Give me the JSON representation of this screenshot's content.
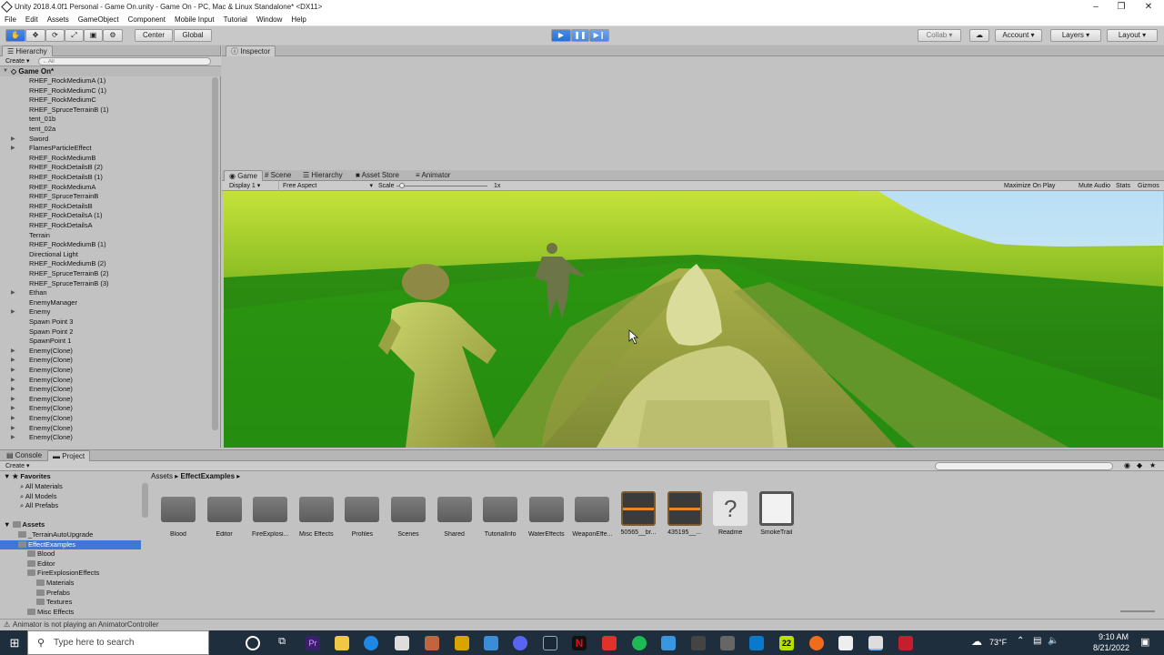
{
  "window": {
    "title": "Unity 2018.4.0f1 Personal - Game On.unity - Game On - PC, Mac & Linux Standalone* <DX11>"
  },
  "menu": [
    "File",
    "Edit",
    "Assets",
    "GameObject",
    "Component",
    "Mobile Input",
    "Tutorial",
    "Window",
    "Help"
  ],
  "toolbar": {
    "center_label": "Center",
    "global_label": "Global",
    "collab_label": "Collab ▾",
    "account_label": "Account",
    "layers_label": "Layers",
    "layout_label": "Layout"
  },
  "hierarchy": {
    "tab": "Hierarchy",
    "create_label": "Create ▾",
    "search_placeholder": "←All",
    "scene_name": "Game On*",
    "items": [
      {
        "name": "RHEF_RockMediumA (1)",
        "arrow": false
      },
      {
        "name": "RHEF_RockMediumC (1)",
        "arrow": false
      },
      {
        "name": "RHEF_RockMediumC",
        "arrow": false
      },
      {
        "name": "RHEF_SpruceTerrainB (1)",
        "arrow": false
      },
      {
        "name": "tent_01b",
        "arrow": false
      },
      {
        "name": "tent_02a",
        "arrow": false
      },
      {
        "name": "Sword",
        "arrow": true
      },
      {
        "name": "FlamesParticleEffect",
        "arrow": true
      },
      {
        "name": "RHEF_RockMediumB",
        "arrow": false
      },
      {
        "name": "RHEF_RockDetailsB (2)",
        "arrow": false
      },
      {
        "name": "RHEF_RockDetailsB (1)",
        "arrow": false
      },
      {
        "name": "RHEF_RockMediumA",
        "arrow": false
      },
      {
        "name": "RHEF_SpruceTerrainB",
        "arrow": false
      },
      {
        "name": "RHEF_RockDetailsB",
        "arrow": false
      },
      {
        "name": "RHEF_RockDetailsA (1)",
        "arrow": false
      },
      {
        "name": "RHEF_RockDetailsA",
        "arrow": false
      },
      {
        "name": "Terrain",
        "arrow": false
      },
      {
        "name": "RHEF_RockMediumB (1)",
        "arrow": false
      },
      {
        "name": "Directional Light",
        "arrow": false
      },
      {
        "name": "RHEF_RockMediumB (2)",
        "arrow": false
      },
      {
        "name": "RHEF_SpruceTerrainB (2)",
        "arrow": false
      },
      {
        "name": "RHEF_SpruceTerrainB (3)",
        "arrow": false
      },
      {
        "name": "Ethan",
        "arrow": true
      },
      {
        "name": "EnemyManager",
        "arrow": false
      },
      {
        "name": "Enemy",
        "arrow": true
      },
      {
        "name": "Spawn Point 3",
        "arrow": false
      },
      {
        "name": "Spawn Point 2",
        "arrow": false
      },
      {
        "name": "SpawnPoint 1",
        "arrow": false
      },
      {
        "name": "Enemy(Clone)",
        "arrow": true
      },
      {
        "name": "Enemy(Clone)",
        "arrow": true
      },
      {
        "name": "Enemy(Clone)",
        "arrow": true
      },
      {
        "name": "Enemy(Clone)",
        "arrow": true
      },
      {
        "name": "Enemy(Clone)",
        "arrow": true
      },
      {
        "name": "Enemy(Clone)",
        "arrow": true
      },
      {
        "name": "Enemy(Clone)",
        "arrow": true
      },
      {
        "name": "Enemy(Clone)",
        "arrow": true
      },
      {
        "name": "Enemy(Clone)",
        "arrow": true
      },
      {
        "name": "Enemy(Clone)",
        "arrow": true
      }
    ]
  },
  "inspector": {
    "tab": "Inspector"
  },
  "game": {
    "tabs": [
      "Game",
      "Scene",
      "Hierarchy",
      "Asset Store",
      "Animator"
    ],
    "display": "Display 1",
    "aspect": "Free Aspect",
    "scale_label": "Scale",
    "scale_value": "1x",
    "options": [
      "Maximize On Play",
      "Mute Audio",
      "Stats",
      "Gizmos"
    ]
  },
  "project": {
    "tabs": [
      "Console",
      "Project"
    ],
    "create_label": "Create ▾",
    "breadcrumb": [
      "Assets",
      "EffectExamples"
    ],
    "favorites_label": "Favorites",
    "favorites": [
      "All Materials",
      "All Models",
      "All Prefabs"
    ],
    "assets_label": "Assets",
    "tree": [
      {
        "name": "_TerrainAutoUpgrade",
        "level": 1,
        "selected": false
      },
      {
        "name": "EffectExamples",
        "level": 1,
        "selected": true
      },
      {
        "name": "Blood",
        "level": 2,
        "selected": false
      },
      {
        "name": "Editor",
        "level": 2,
        "selected": false
      },
      {
        "name": "FireExplosionEffects",
        "level": 2,
        "selected": false
      },
      {
        "name": "Materials",
        "level": 3,
        "selected": false
      },
      {
        "name": "Prefabs",
        "level": 3,
        "selected": false
      },
      {
        "name": "Textures",
        "level": 3,
        "selected": false
      },
      {
        "name": "Misc Effects",
        "level": 2,
        "selected": false
      }
    ],
    "grid": [
      {
        "label": "Blood",
        "kind": "folder"
      },
      {
        "label": "Editor",
        "kind": "folder"
      },
      {
        "label": "FireExplosi...",
        "kind": "folder"
      },
      {
        "label": "Misc Effects",
        "kind": "folder"
      },
      {
        "label": "Profiles",
        "kind": "folder"
      },
      {
        "label": "Scenes",
        "kind": "folder"
      },
      {
        "label": "Shared",
        "kind": "folder"
      },
      {
        "label": "TutorialInfo",
        "kind": "folder"
      },
      {
        "label": "WaterEffects",
        "kind": "folder"
      },
      {
        "label": "WeaponEffe...",
        "kind": "folder"
      },
      {
        "label": "50565__br...",
        "kind": "audio"
      },
      {
        "label": "435195__...",
        "kind": "audio"
      },
      {
        "label": "Readme",
        "kind": "readme"
      },
      {
        "label": "SmokeTrail",
        "kind": "material"
      }
    ]
  },
  "status": {
    "message": "Animator is not playing an AnimatorController"
  },
  "taskbar": {
    "search_placeholder": "Type here to search",
    "weather": "73°F",
    "time": "9:10 AM",
    "date": "8/21/2022"
  },
  "colors": {
    "play_active": "#2c6fd1",
    "selection": "#3d78d6"
  }
}
